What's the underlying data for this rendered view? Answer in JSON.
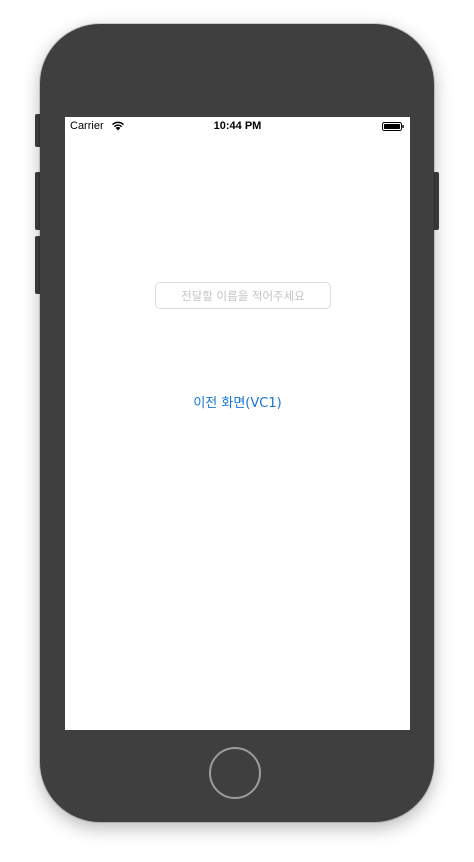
{
  "status_bar": {
    "carrier": "Carrier",
    "time": "10:44 PM",
    "wifi_icon": "wifi-icon",
    "battery_icon": "battery-icon"
  },
  "main": {
    "name_input": {
      "value": "",
      "placeholder": "전달할 이름을 적어주세요"
    },
    "previous_button_label": "이전 화면(VC1)"
  },
  "colors": {
    "device_frame": "#3f3f3f",
    "link_blue": "#1676d2",
    "screen_background": "#ffffff"
  }
}
